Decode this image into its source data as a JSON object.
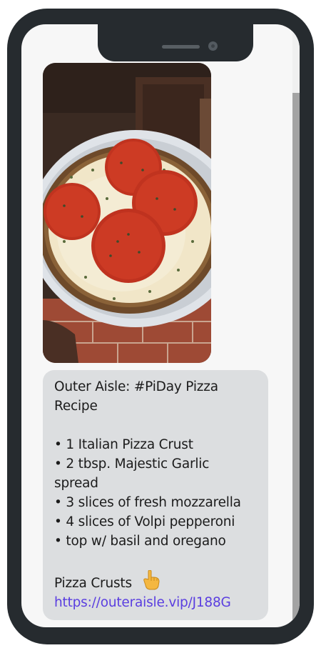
{
  "message": {
    "image": {
      "description_icon": "pizza-photo"
    },
    "title_lines": [
      "Outer Aisle: #PiDay Pizza",
      "Recipe"
    ],
    "ingredient_lines": [
      "• 1 Italian Pizza Crust",
      "• 2 tbsp. Majestic Garlic",
      "spread",
      "• 3 slices of fresh mozzarella",
      "• 4 slices of Volpi pepperoni",
      "• top w/ basil and oregano"
    ],
    "cta_text": "Pizza Crusts",
    "cta_emoji_icon": "pointing-down-hand-icon",
    "link_url": "https://outeraisle.vip/J188G"
  }
}
